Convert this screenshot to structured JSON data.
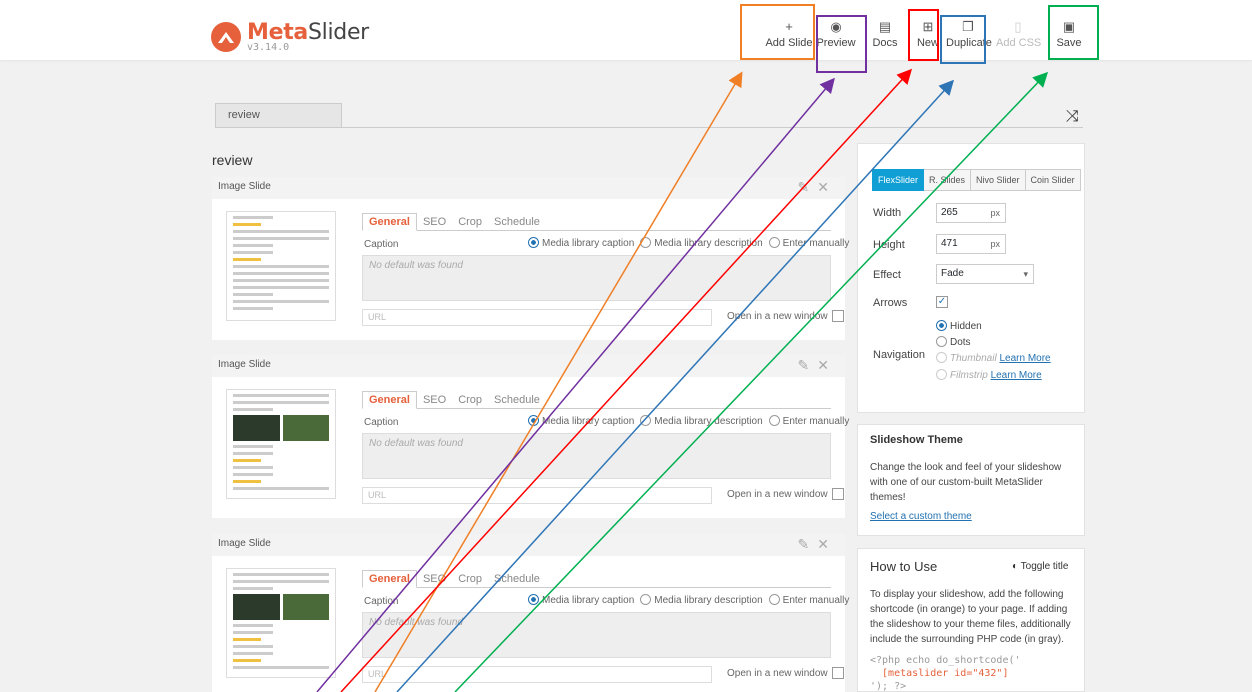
{
  "header": {
    "brand_prefix": "Meta",
    "brand_suffix": "Slider",
    "version": "v3.14.0",
    "buttons": [
      {
        "label": "Add Slide",
        "icon": "+",
        "icon_name": "plus-icon"
      },
      {
        "label": "Preview",
        "icon": "◉",
        "icon_name": "eye-icon"
      },
      {
        "label": "Docs",
        "icon": "▤",
        "icon_name": "book-icon"
      },
      {
        "label": "New",
        "icon": "⊞",
        "icon_name": "plus-square-icon"
      },
      {
        "label": "Duplicate",
        "icon": "❐",
        "icon_name": "copy-icon"
      },
      {
        "label": "Add CSS",
        "icon": "▯",
        "icon_name": "file-icon"
      },
      {
        "label": "Save",
        "icon": "▣",
        "icon_name": "save-icon"
      }
    ]
  },
  "slideshow": {
    "tab_label": "review",
    "title": "review"
  },
  "slides": [
    {
      "type": "Image Slide"
    },
    {
      "type": "Image Slide"
    },
    {
      "type": "Image Slide"
    }
  ],
  "slide_editor": {
    "tabs": [
      "General",
      "SEO",
      "Crop",
      "Schedule"
    ],
    "caption_label": "Caption",
    "caption_options": [
      "Media library caption",
      "Media library description",
      "Enter manually"
    ],
    "caption_placeholder": "No default was found",
    "url_placeholder": "URL",
    "new_window_label": "Open in a new window"
  },
  "settings": {
    "library_tabs": [
      "FlexSlider",
      "R. Slides",
      "Nivo Slider",
      "Coin Slider"
    ],
    "width_label": "Width",
    "width_value": "265",
    "height_label": "Height",
    "height_value": "471",
    "unit": "px",
    "effect_label": "Effect",
    "effect_value": "Fade",
    "arrows_label": "Arrows",
    "navigation_label": "Navigation",
    "nav_options": [
      "Hidden",
      "Dots",
      "Thumbnail",
      "Filmstrip"
    ],
    "learn_more": "Learn More"
  },
  "theme": {
    "title": "Slideshow Theme",
    "description": "Change the look and feel of your slideshow with one of our custom-built MetaSlider themes!",
    "link": "Select a custom theme"
  },
  "how_to_use": {
    "title": "How to Use",
    "toggle": "Toggle title",
    "description": "To display your slideshow, add the following shortcode (in orange) to your page. If adding the slideshow to your theme files, additionally include the surrounding PHP code (in gray).",
    "code_line1": "<?php echo do_shortcode('",
    "code_line2": "  [metaslider id=\"432\"]",
    "code_line3": "'); ?>"
  },
  "annotation_colors": {
    "add_slide": "#f07f26",
    "preview": "#7030a0",
    "new": "#ff0000",
    "duplicate": "#2e75b6",
    "save": "#00b050"
  }
}
